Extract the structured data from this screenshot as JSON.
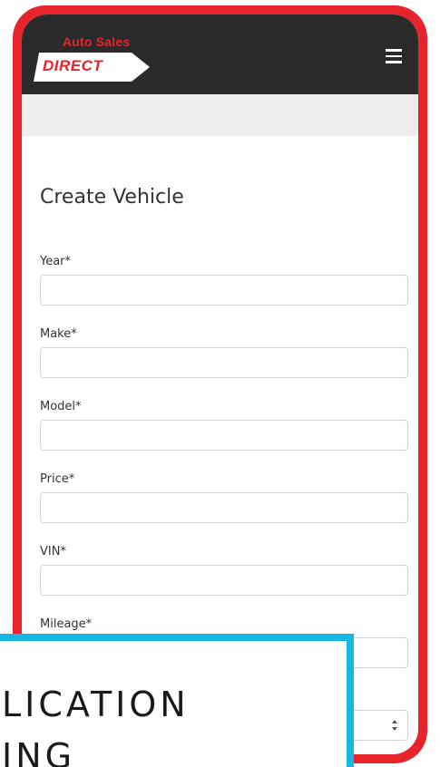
{
  "header": {
    "logo_top": "Auto Sales",
    "logo_word": "DIRECT",
    "menu_icon": "hamburger-menu-icon"
  },
  "form": {
    "title": "Create Vehicle",
    "fields": [
      {
        "label": "Year*",
        "value": "",
        "placeholder": ""
      },
      {
        "label": "Make*",
        "value": "",
        "placeholder": ""
      },
      {
        "label": "Model*",
        "value": "",
        "placeholder": ""
      },
      {
        "label": "Price*",
        "value": "",
        "placeholder": ""
      },
      {
        "label": "VIN*",
        "value": "",
        "placeholder": ""
      },
      {
        "label": "Mileage*",
        "value": "",
        "placeholder": ""
      }
    ],
    "select_icon": "select-arrows-icon"
  },
  "banner": {
    "line1": "LICATION",
    "line2": "ING"
  },
  "colors": {
    "brand_red": "#e7232b",
    "header_dark": "#2a2a2a",
    "banner_blue": "#16b8e2"
  }
}
